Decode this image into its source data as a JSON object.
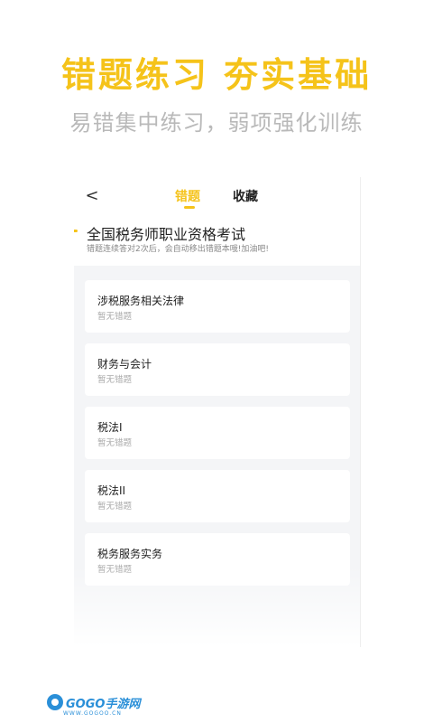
{
  "promo": {
    "headline": "错题练习 夯实基础",
    "subline": "易错集中练习，弱项强化训练"
  },
  "topbar": {
    "back_icon": "<",
    "tabs": [
      {
        "label": "错题",
        "active": true
      },
      {
        "label": "收藏",
        "active": false
      }
    ]
  },
  "exam": {
    "title": "全国税务师职业资格考试",
    "hint": "错题连续答对2次后，会自动移出错题本哦!加油吧!"
  },
  "subjects": [
    {
      "title": "涉税服务相关法律",
      "status": "暂无错题"
    },
    {
      "title": "财务与会计",
      "status": "暂无错题"
    },
    {
      "title": "税法I",
      "status": "暂无错题"
    },
    {
      "title": "税法II",
      "status": "暂无错题"
    },
    {
      "title": "税务服务实务",
      "status": "暂无错题"
    }
  ],
  "watermark": {
    "logo_text": "GOGO手游网",
    "url": "WWW.GOGOO.CN"
  },
  "colors": {
    "accent": "#f5c31a",
    "brand_blue": "#2a8fd8"
  }
}
